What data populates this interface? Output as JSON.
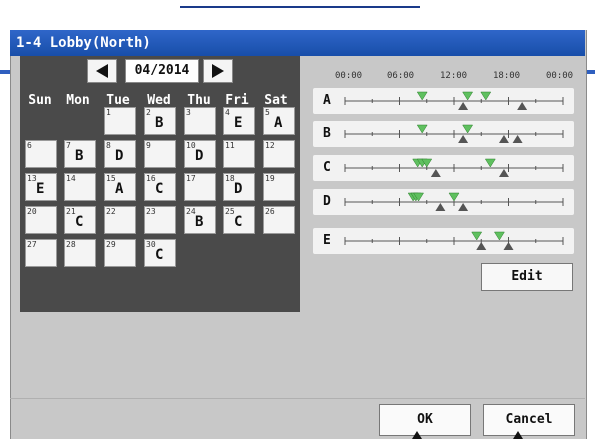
{
  "window": {
    "title": "1-4 Lobby(North)"
  },
  "calendar": {
    "month": "04/2014",
    "days_of_week": [
      "Sun",
      "Mon",
      "Tue",
      "Wed",
      "Thu",
      "Fri",
      "Sat"
    ],
    "days": [
      {
        "num": "1",
        "letter": ""
      },
      {
        "num": "2",
        "letter": "B"
      },
      {
        "num": "3",
        "letter": ""
      },
      {
        "num": "4",
        "letter": "E"
      },
      {
        "num": "5",
        "letter": "A"
      },
      {
        "num": "6",
        "letter": ""
      },
      {
        "num": "7",
        "letter": "B"
      },
      {
        "num": "8",
        "letter": "D"
      },
      {
        "num": "9",
        "letter": ""
      },
      {
        "num": "10",
        "letter": "D"
      },
      {
        "num": "11",
        "letter": ""
      },
      {
        "num": "12",
        "letter": ""
      },
      {
        "num": "13",
        "letter": "E"
      },
      {
        "num": "14",
        "letter": ""
      },
      {
        "num": "15",
        "letter": "A"
      },
      {
        "num": "16",
        "letter": "C"
      },
      {
        "num": "17",
        "letter": ""
      },
      {
        "num": "18",
        "letter": "D"
      },
      {
        "num": "19",
        "letter": ""
      },
      {
        "num": "20",
        "letter": ""
      },
      {
        "num": "21",
        "letter": "C"
      },
      {
        "num": "22",
        "letter": ""
      },
      {
        "num": "23",
        "letter": ""
      },
      {
        "num": "24",
        "letter": "B"
      },
      {
        "num": "25",
        "letter": "C"
      },
      {
        "num": "26",
        "letter": ""
      },
      {
        "num": "27",
        "letter": ""
      },
      {
        "num": "28",
        "letter": ""
      },
      {
        "num": "29",
        "letter": ""
      },
      {
        "num": "30",
        "letter": "C"
      }
    ]
  },
  "timeline": {
    "time_labels": [
      "00:00",
      "06:00",
      "12:00",
      "18:00",
      "00:00"
    ],
    "patterns": [
      {
        "label": "A",
        "on_times": [
          8.5,
          13.5,
          15.5
        ],
        "off_times": [
          13.0,
          19.5
        ]
      },
      {
        "label": "B",
        "on_times": [
          8.5,
          13.5
        ],
        "off_times": [
          13.0,
          17.5,
          19.0
        ]
      },
      {
        "label": "C",
        "on_times": [
          8.0,
          8.5,
          9.0,
          16.0
        ],
        "off_times": [
          10.0,
          17.5
        ]
      },
      {
        "label": "D",
        "on_times": [
          7.5,
          7.8,
          8.1,
          12.0
        ],
        "off_times": [
          10.5,
          13.0
        ]
      },
      {
        "label": "E",
        "on_times": [
          14.5,
          17.0
        ],
        "off_times": [
          15.0,
          18.0
        ]
      }
    ]
  },
  "buttons": {
    "edit": "Edit",
    "ok": "OK",
    "cancel": "Cancel"
  },
  "icons": {
    "prev": "prev-month-icon",
    "next": "next-month-icon"
  },
  "colors": {
    "title_bar": "#2a5fc0",
    "on_marker": "#5fc05f",
    "off_marker": "#555555"
  }
}
